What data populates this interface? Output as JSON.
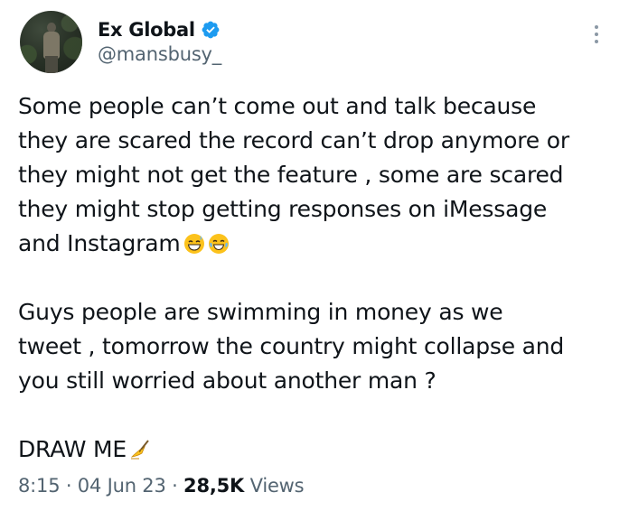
{
  "author": {
    "display_name": "Ex Global",
    "handle": "@mansbusy_",
    "verified_icon": "verified-badge-icon"
  },
  "tweet": {
    "paragraph1": {
      "line1": "Some people can’t come out and talk because",
      "line2": "they are scared the record can’t drop anymore or",
      "line3": "they might not get the feature , some are scared",
      "line4": "they might stop getting responses on iMessage",
      "line5": "and Instagram"
    },
    "paragraph1_emojis": [
      "grinning-sweat-emoji",
      "tears-of-joy-emoji"
    ],
    "paragraph2": {
      "line1": "Guys people are swimming in money as we",
      "line2": "tweet  , tomorrow the country might collapse and",
      "line3": "you still worried about another man ?"
    },
    "paragraph3": {
      "line1": "DRAW ME"
    },
    "paragraph3_emoji": "writing-hand-emoji"
  },
  "meta": {
    "time": "8:15",
    "separator1": " · ",
    "date": "04 Jun 23",
    "separator2": " · ",
    "views_count": "28,5K",
    "views_label": " Views"
  },
  "colors": {
    "text_primary": "#0f1419",
    "text_secondary": "#536471",
    "verified_blue": "#1d9bf0",
    "more_dots": "#8b98a5"
  }
}
